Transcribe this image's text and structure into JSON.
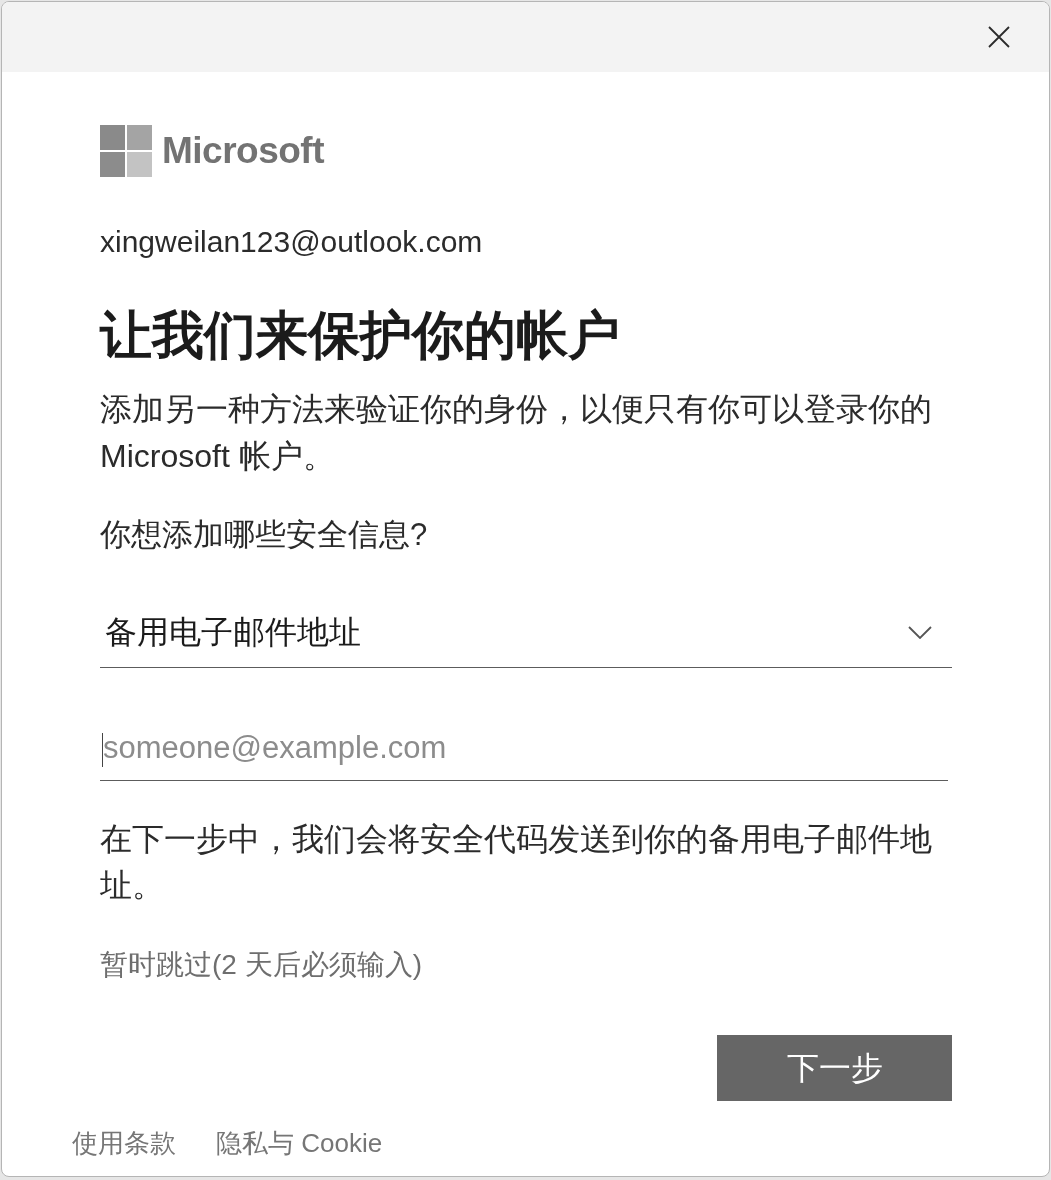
{
  "logo": {
    "wordmark": "Microsoft"
  },
  "account_email": "xingweilan123@outlook.com",
  "title": "让我们来保护你的帐户",
  "description": "添加另一种方法来验证你的身份，以便只有你可以登录你的 Microsoft 帐户。",
  "question": "你想添加哪些安全信息?",
  "method_dropdown": {
    "value": "备用电子邮件地址"
  },
  "email_field": {
    "placeholder": "someone@example.com",
    "focused": true
  },
  "info": "在下一步中，我们会将安全代码发送到你的备用电子邮件地址。",
  "skip_link": "暂时跳过(2 天后必须输入)",
  "next_button": "下一步",
  "footer_links": [
    "使用条款",
    "隐私与 Cookie"
  ]
}
